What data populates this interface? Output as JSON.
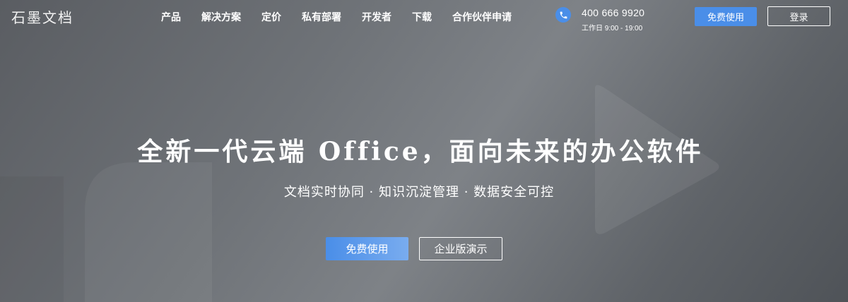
{
  "header": {
    "logo_text": "石墨文档",
    "nav": [
      {
        "label": "产品"
      },
      {
        "label": "解决方案"
      },
      {
        "label": "定价"
      },
      {
        "label": "私有部署"
      },
      {
        "label": "开发者"
      },
      {
        "label": "下载"
      },
      {
        "label": "合作伙伴申请"
      }
    ],
    "phone": {
      "icon": "phone-icon",
      "number": "400 666 9920",
      "hours": "工作日 9:00 - 19:00"
    },
    "free_button_label": "免费使用",
    "login_button_label": "登录"
  },
  "hero": {
    "headline": "全新一代云端 Office，面向未来的办公软件",
    "subline": "文档实时协同 · 知识沉淀管理 · 数据安全可控",
    "free_button_label": "免费使用",
    "demo_button_label": "企业版演示"
  },
  "colors": {
    "accent": "#4a8ee8",
    "accent_light": "#79acef",
    "background": "#6f7378",
    "text": "#ffffff"
  }
}
